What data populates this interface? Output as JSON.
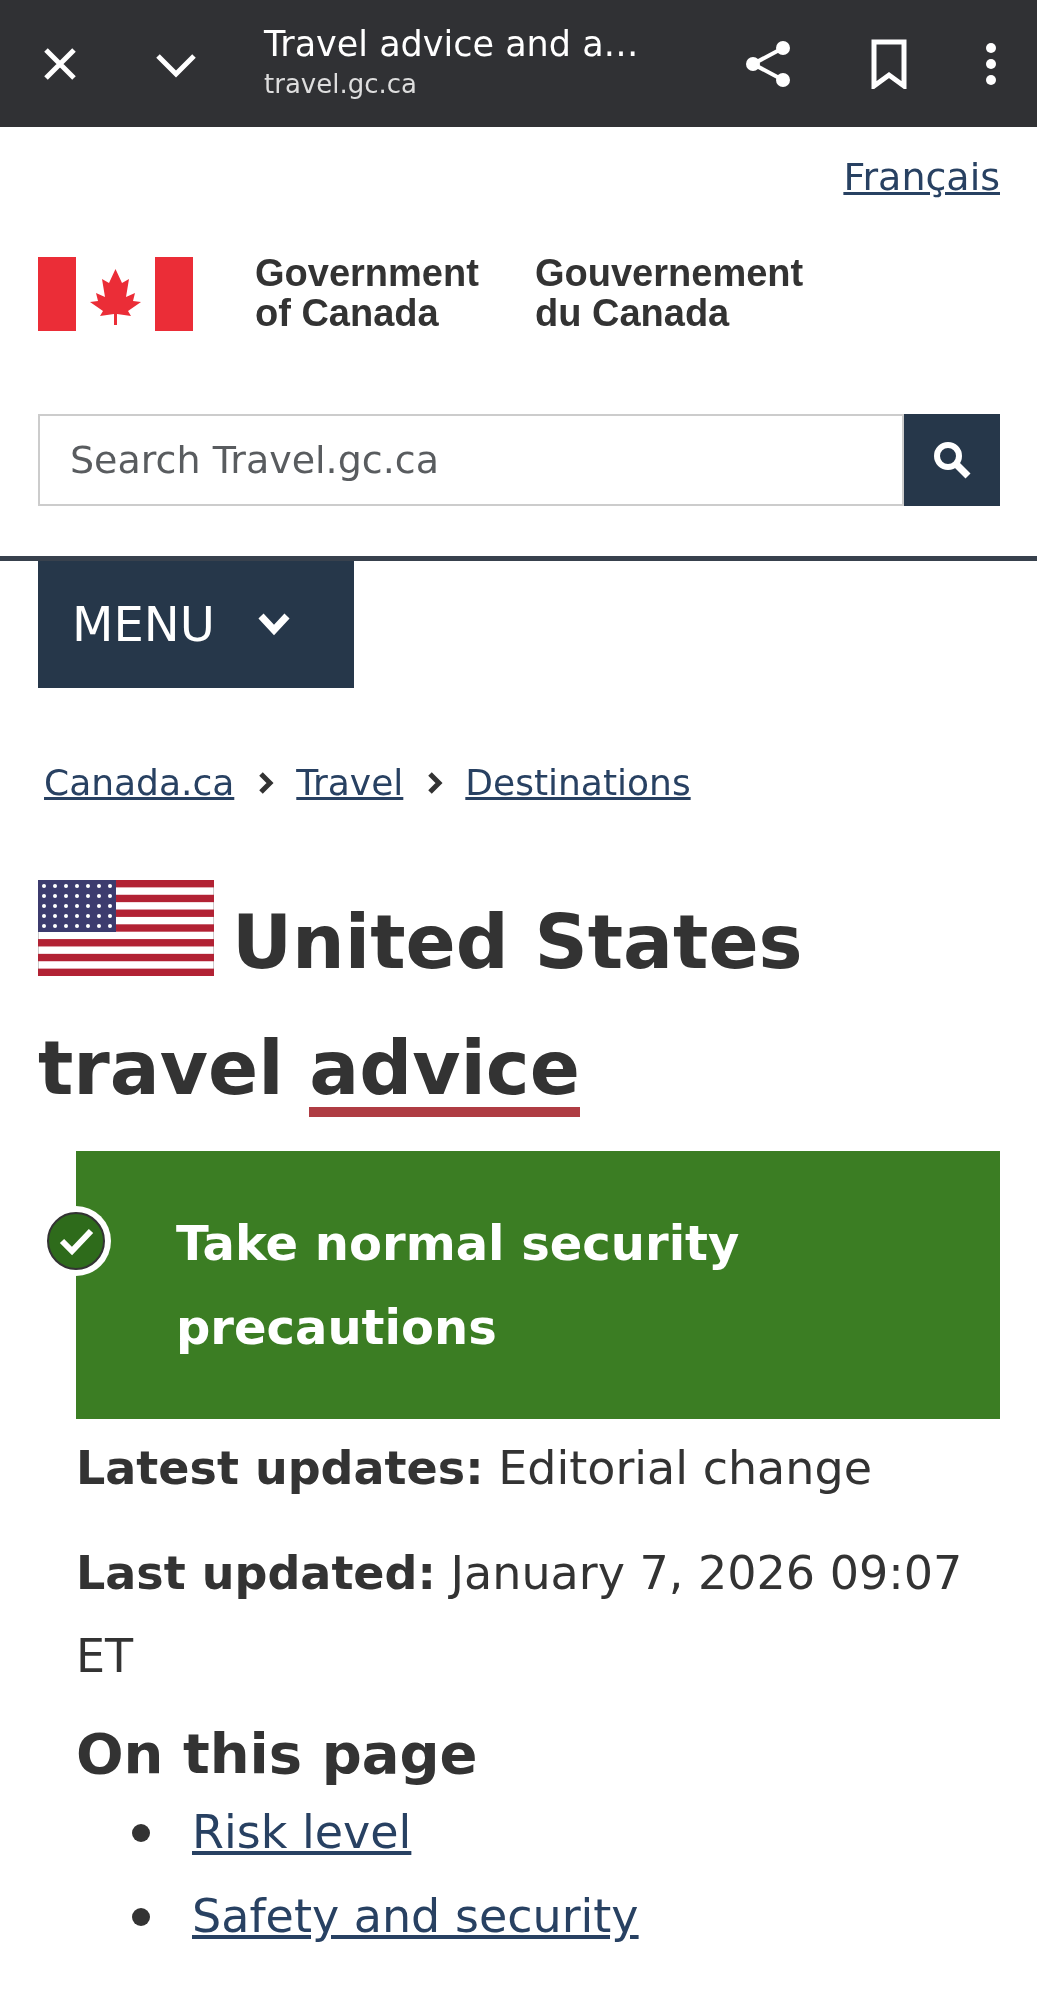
{
  "browser_bar": {
    "title": "Travel advice and a…",
    "url": "travel.gc.ca"
  },
  "language_link": "Français",
  "signature": {
    "english": "Government of Canada",
    "french": "Gouvernement du Canada"
  },
  "search": {
    "placeholder": "Search Travel.gc.ca"
  },
  "menu_button": "MENU",
  "breadcrumbs": [
    "Canada.ca",
    "Travel",
    "Destinations"
  ],
  "heading": "United States travel advice",
  "risk_banner": {
    "text": "Take normal security precautions"
  },
  "updates": [
    {
      "label": "Latest updates:",
      "value": "Editorial change"
    },
    {
      "label": "Last updated:",
      "value": "January 7, 2026 09:07 ET"
    }
  ],
  "on_this_page": {
    "title": "On this page",
    "links": [
      "Risk level",
      "Safety and security"
    ]
  }
}
